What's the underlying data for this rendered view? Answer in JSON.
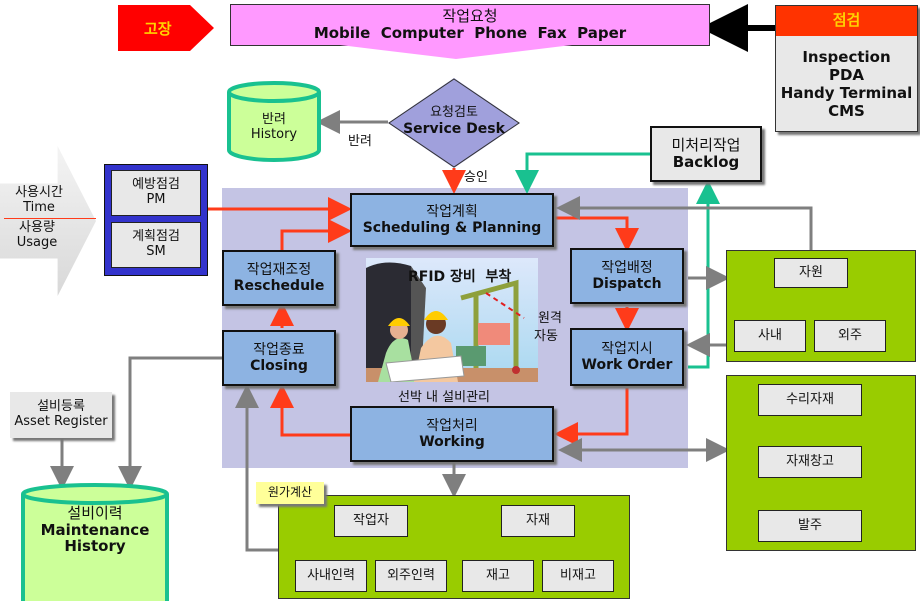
{
  "fault": {
    "label": "고장",
    "color": "#ff0000"
  },
  "request": {
    "title": "작업요청",
    "channels": "Mobile  Computer  Phone  Fax  Paper",
    "color": "#ff99ff"
  },
  "inspection": {
    "header": "점검",
    "lines": [
      "Inspection",
      "PDA",
      "Handy Terminal",
      "CMS"
    ],
    "header_color": "#ff3300"
  },
  "return_history": {
    "ko": "반려",
    "en": "History"
  },
  "service_desk": {
    "ko": "요청검토",
    "en": "Service Desk"
  },
  "edge_labels": {
    "return": "반려",
    "approve": "승인"
  },
  "backlog": {
    "ko": "미처리작업",
    "en": "Backlog"
  },
  "usage": {
    "time_ko": "사용시간",
    "time_en": "Time",
    "usage_ko": "사용량",
    "usage_en": "Usage"
  },
  "pm": {
    "ko": "예방점검",
    "en": "PM"
  },
  "sm": {
    "ko": "계획점검",
    "en": "SM"
  },
  "planning": {
    "ko": "작업계획",
    "en": "Scheduling & Planning"
  },
  "reschedule": {
    "ko": "작업재조정",
    "en": "Reschedule"
  },
  "dispatch": {
    "ko": "작업배정",
    "en": "Dispatch"
  },
  "closing": {
    "ko": "작업종료",
    "en": "Closing"
  },
  "work_order": {
    "ko": "작업지시",
    "en": "Work Order"
  },
  "working": {
    "ko": "작업처리",
    "en": "Working"
  },
  "illustration": {
    "top_caption": "RFID 장비  부착",
    "bottom_caption": "선박 내 설비관리",
    "remote_1": "원격",
    "remote_2": "자동"
  },
  "resources": {
    "root": "자원",
    "children": [
      "사내",
      "외주"
    ]
  },
  "materials": {
    "items": [
      "수리자재",
      "자재창고",
      "발주"
    ]
  },
  "asset_register": {
    "ko": "설비등록",
    "en": "Asset Register"
  },
  "maintenance_history": {
    "ko": "설비이력",
    "en1": "Maintenance",
    "en2": "History"
  },
  "cost": {
    "label": "원가계산",
    "worker": "작업자",
    "worker_children": [
      "사내인력",
      "외주인력"
    ],
    "material": "자재",
    "material_children": [
      "재고",
      "비재고"
    ]
  }
}
